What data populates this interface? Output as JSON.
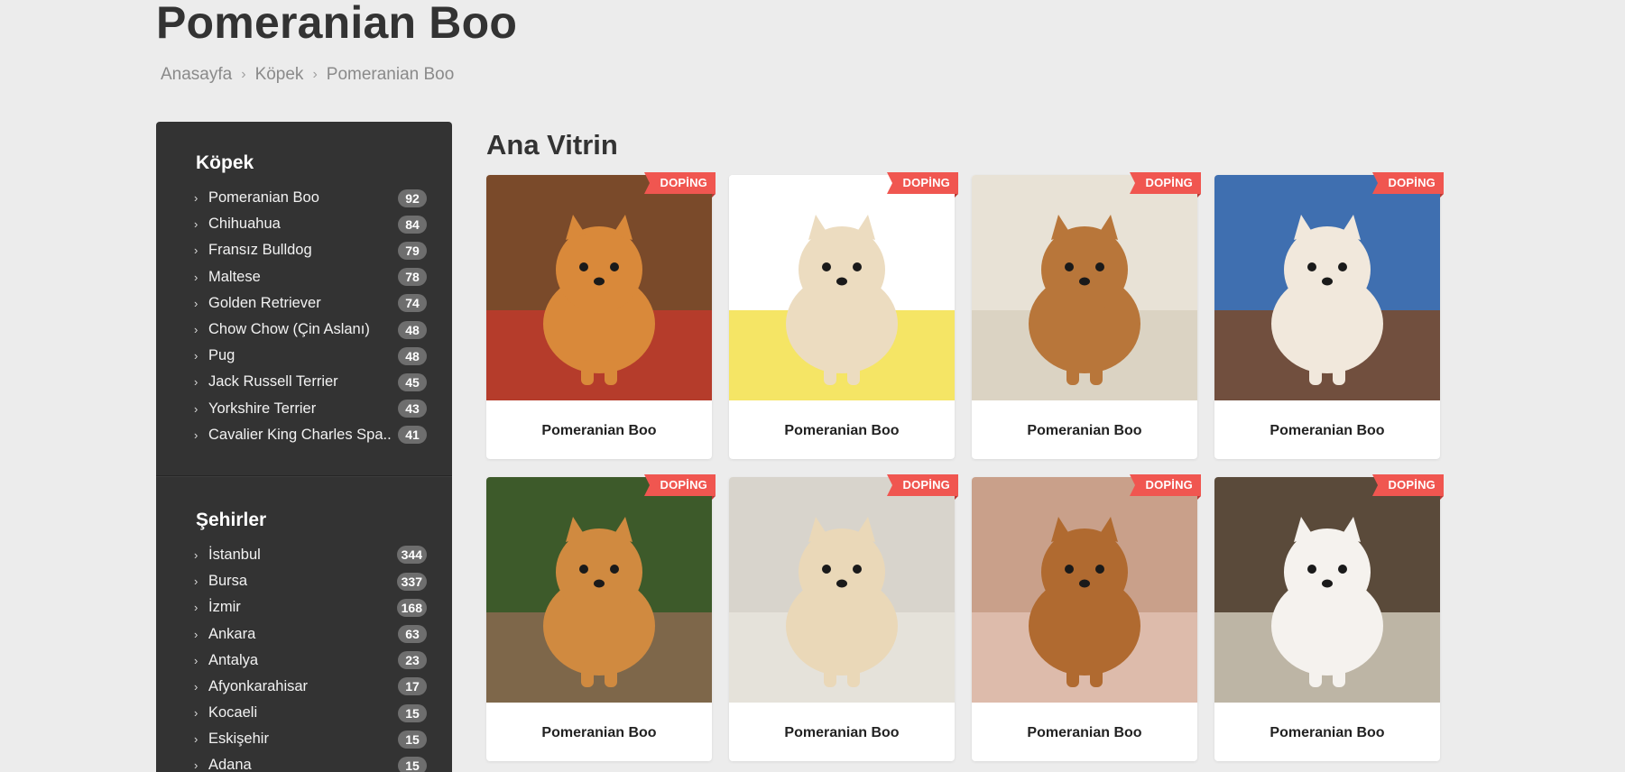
{
  "page": {
    "title": "Pomeranian Boo"
  },
  "breadcrumb": [
    {
      "label": "Anasayfa"
    },
    {
      "label": "Köpek"
    },
    {
      "label": "Pomeranian Boo"
    }
  ],
  "sidebar": {
    "categories": {
      "title": "Köpek",
      "items": [
        {
          "label": "Pomeranian Boo",
          "count": "92"
        },
        {
          "label": "Chihuahua",
          "count": "84"
        },
        {
          "label": "Fransız Bulldog",
          "count": "79"
        },
        {
          "label": "Maltese",
          "count": "78"
        },
        {
          "label": "Golden Retriever",
          "count": "74"
        },
        {
          "label": "Chow Chow (Çin Aslanı)",
          "count": "48"
        },
        {
          "label": "Pug",
          "count": "48"
        },
        {
          "label": "Jack Russell Terrier",
          "count": "45"
        },
        {
          "label": "Yorkshire Terrier",
          "count": "43"
        },
        {
          "label": "Cavalier King Charles Spa..",
          "count": "41"
        }
      ]
    },
    "cities": {
      "title": "Şehirler",
      "items": [
        {
          "label": "İstanbul",
          "count": "344"
        },
        {
          "label": "Bursa",
          "count": "337"
        },
        {
          "label": "İzmir",
          "count": "168"
        },
        {
          "label": "Ankara",
          "count": "63"
        },
        {
          "label": "Antalya",
          "count": "23"
        },
        {
          "label": "Afyonkarahisar",
          "count": "17"
        },
        {
          "label": "Kocaeli",
          "count": "15"
        },
        {
          "label": "Eskişehir",
          "count": "15"
        },
        {
          "label": "Adana",
          "count": "15"
        }
      ]
    }
  },
  "showcase": {
    "heading": "Ana Vitrin",
    "ribbon_label": "DOPİNG",
    "cards": [
      {
        "name": "Pomeranian Boo",
        "image": "orange pomeranian puppy with toys",
        "palette": {
          "bg1": "#7a4a2a",
          "bg2": "#c0392b",
          "dog": "#d9893a"
        }
      },
      {
        "name": "Pomeranian Boo",
        "image": "cream pomeranian puppy smiling",
        "palette": {
          "bg1": "#ffffff",
          "bg2": "#f3e04a",
          "dog": "#ecdcc0"
        }
      },
      {
        "name": "Pomeranian Boo",
        "image": "small tan pomeranian on sofa",
        "palette": {
          "bg1": "#e8e2d6",
          "bg2": "#d8d0c0",
          "dog": "#b8763a"
        }
      },
      {
        "name": "Pomeranian Boo",
        "image": "white pomeranian with plush toys",
        "palette": {
          "bg1": "#3f6fb0",
          "bg2": "#7a4a2a",
          "dog": "#f1e8dc"
        }
      },
      {
        "name": "Pomeranian Boo",
        "image": "orange pomeranian on grass",
        "palette": {
          "bg1": "#3d5a2a",
          "bg2": "#8a6a50",
          "dog": "#d08a40"
        }
      },
      {
        "name": "Pomeranian Boo",
        "image": "cream pomeranian in wicker basket",
        "palette": {
          "bg1": "#d8d4cc",
          "bg2": "#e8e4dc",
          "dog": "#ead8b8"
        }
      },
      {
        "name": "Pomeranian Boo",
        "image": "brown pomeranian puppy held in hands",
        "palette": {
          "bg1": "#c9a08a",
          "bg2": "#e0c0b0",
          "dog": "#b06a30"
        }
      },
      {
        "name": "Pomeranian Boo",
        "image": "white fluffy pomeranian on bench",
        "palette": {
          "bg1": "#5a4a3a",
          "bg2": "#cfc8b8",
          "dog": "#f5f2ee"
        }
      }
    ]
  }
}
